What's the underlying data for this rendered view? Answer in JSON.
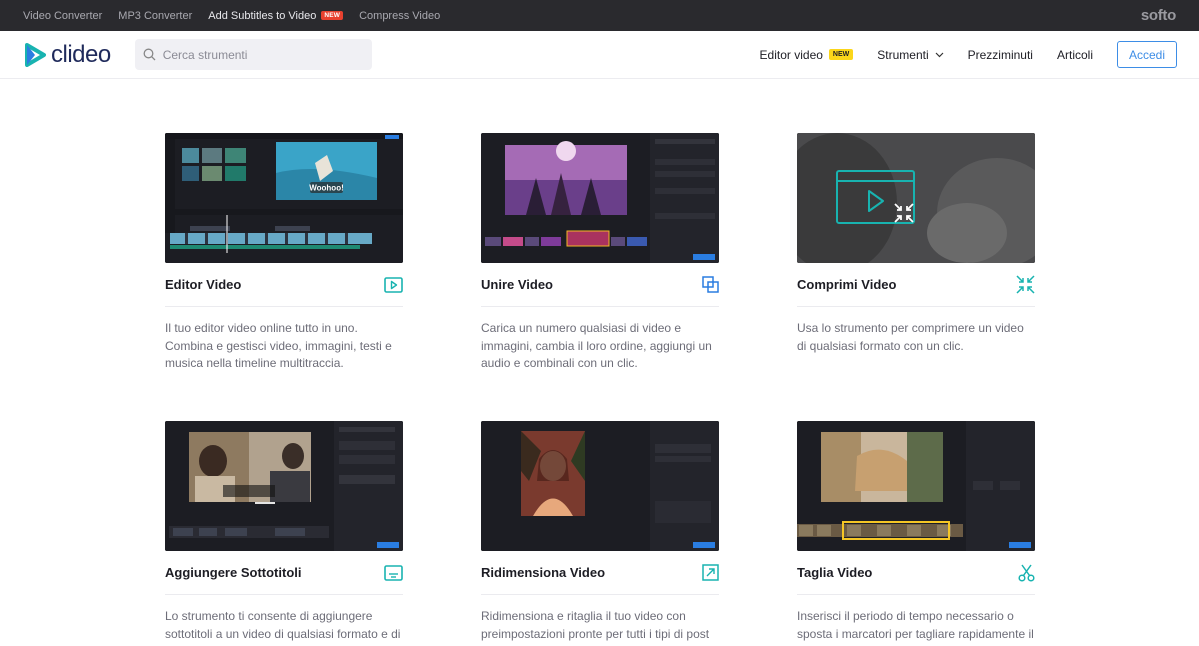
{
  "topbar": {
    "links": [
      "Video Converter",
      "MP3 Converter",
      "Add Subtitles to Video",
      "Compress Video"
    ],
    "new_badge": "NEW",
    "brand": "softo"
  },
  "header": {
    "logo": "clideo",
    "search_placeholder": "Cerca strumenti",
    "nav": {
      "editor": "Editor video",
      "editor_badge": "NEW",
      "tools": "Strumenti",
      "prices": "Prezziminuti",
      "articles": "Articoli",
      "login": "Accedi"
    }
  },
  "cards": [
    {
      "title": "Editor Video",
      "icon": "play-square-icon",
      "desc": "Il tuo editor video online tutto in uno. Combina e gestisci video, immagini, testi e musica nella timeline multitraccia.",
      "thumb_text": "Woohoo!"
    },
    {
      "title": "Unire Video",
      "icon": "merge-squares-icon",
      "desc": "Carica un numero qualsiasi di video e immagini, cambia il loro ordine, aggiungi un audio e combinali con un clic."
    },
    {
      "title": "Comprimi Video",
      "icon": "compress-arrows-icon",
      "desc": "Usa lo strumento per comprimere un video di qualsiasi formato con un clic."
    },
    {
      "title": "Aggiungere Sottotitoli",
      "icon": "subtitles-icon",
      "desc": "Lo strumento ti consente di aggiungere sottotitoli a un video di qualsiasi formato e di"
    },
    {
      "title": "Ridimensiona Video",
      "icon": "resize-arrow-icon",
      "desc": "Ridimensiona e ritaglia il tuo video con preimpostazioni pronte per tutti i tipi di post"
    },
    {
      "title": "Taglia Video",
      "icon": "scissors-icon",
      "desc": "Inserisci il periodo di tempo necessario o sposta i marcatori per tagliare rapidamente il"
    }
  ],
  "colors": {
    "accent": "#3d8de6",
    "teal": "#18b3b0",
    "topbar": "#2a2a2e"
  }
}
